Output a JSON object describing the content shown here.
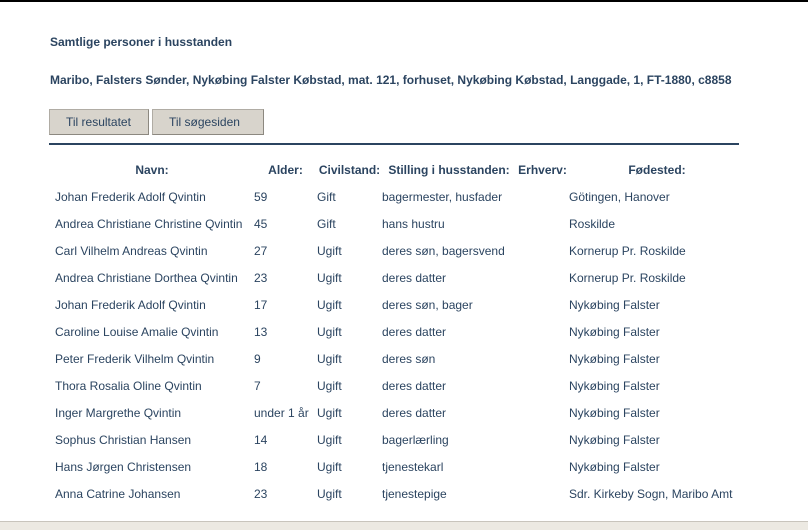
{
  "page": {
    "heading": "Samtlige personer i husstanden",
    "address": "Maribo, Falsters Sønder, Nykøbing Falster Købstad, mat. 121, forhuset, Nykøbing Købstad, Langgade, 1, FT-1880, c8858"
  },
  "buttons": {
    "results_label": "Til resultatet",
    "search_label": "Til søgesiden"
  },
  "table": {
    "headers": {
      "name": "Navn:",
      "age": "Alder:",
      "civil": "Civilstand:",
      "position": "Stilling i husstanden:",
      "occupation": "Erhverv:",
      "birthplace": "Fødested:"
    },
    "rows": [
      {
        "name": "Johan Frederik Adolf Qvintin",
        "age": "59",
        "civil": "Gift",
        "position": "bagermester, husfader",
        "occupation": "",
        "birthplace": "Götingen, Hanover"
      },
      {
        "name": "Andrea Christiane Christine Qvintin",
        "age": "45",
        "civil": "Gift",
        "position": "hans hustru",
        "occupation": "",
        "birthplace": "Roskilde"
      },
      {
        "name": "Carl Vilhelm Andreas Qvintin",
        "age": "27",
        "civil": "Ugift",
        "position": "deres søn, bagersvend",
        "occupation": "",
        "birthplace": "Kornerup Pr. Roskilde"
      },
      {
        "name": "Andrea Christiane Dorthea Qvintin",
        "age": "23",
        "civil": "Ugift",
        "position": "deres datter",
        "occupation": "",
        "birthplace": "Kornerup Pr. Roskilde"
      },
      {
        "name": "Johan Frederik Adolf Qvintin",
        "age": "17",
        "civil": "Ugift",
        "position": "deres søn, bager",
        "occupation": "",
        "birthplace": "Nykøbing Falster"
      },
      {
        "name": "Caroline Louise Amalie Qvintin",
        "age": "13",
        "civil": "Ugift",
        "position": "deres datter",
        "occupation": "",
        "birthplace": "Nykøbing Falster"
      },
      {
        "name": "Peter Frederik Vilhelm Qvintin",
        "age": "9",
        "civil": "Ugift",
        "position": "deres søn",
        "occupation": "",
        "birthplace": "Nykøbing Falster"
      },
      {
        "name": "Thora Rosalia Oline Qvintin",
        "age": "7",
        "civil": "Ugift",
        "position": "deres datter",
        "occupation": "",
        "birthplace": "Nykøbing Falster"
      },
      {
        "name": "Inger Margrethe Qvintin",
        "age": "under 1 år",
        "civil": "Ugift",
        "position": "deres datter",
        "occupation": "",
        "birthplace": "Nykøbing Falster"
      },
      {
        "name": "Sophus Christian Hansen",
        "age": "14",
        "civil": "Ugift",
        "position": "bagerlærling",
        "occupation": "",
        "birthplace": "Nykøbing Falster"
      },
      {
        "name": "Hans Jørgen Christensen",
        "age": "18",
        "civil": "Ugift",
        "position": "tjenestekarl",
        "occupation": "",
        "birthplace": "Nykøbing Falster"
      },
      {
        "name": "Anna Catrine Johansen",
        "age": "23",
        "civil": "Ugift",
        "position": "tjenestepige",
        "occupation": "",
        "birthplace": "Sdr. Kirkeby Sogn, Maribo Amt"
      }
    ]
  },
  "colors": {
    "text": "#2b4460",
    "button_bg": "#d8d4cc",
    "rule": "#2b4460"
  }
}
